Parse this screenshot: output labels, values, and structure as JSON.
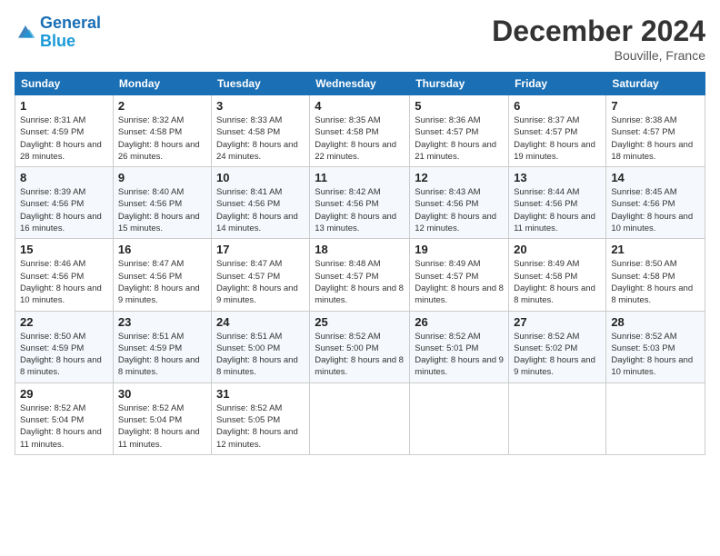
{
  "header": {
    "logo_line1": "General",
    "logo_line2": "Blue",
    "month": "December 2024",
    "location": "Bouville, France"
  },
  "weekdays": [
    "Sunday",
    "Monday",
    "Tuesday",
    "Wednesday",
    "Thursday",
    "Friday",
    "Saturday"
  ],
  "weeks": [
    [
      {
        "day": "1",
        "sunrise": "8:31 AM",
        "sunset": "4:59 PM",
        "daylight": "8 hours and 28 minutes."
      },
      {
        "day": "2",
        "sunrise": "8:32 AM",
        "sunset": "4:58 PM",
        "daylight": "8 hours and 26 minutes."
      },
      {
        "day": "3",
        "sunrise": "8:33 AM",
        "sunset": "4:58 PM",
        "daylight": "8 hours and 24 minutes."
      },
      {
        "day": "4",
        "sunrise": "8:35 AM",
        "sunset": "4:58 PM",
        "daylight": "8 hours and 22 minutes."
      },
      {
        "day": "5",
        "sunrise": "8:36 AM",
        "sunset": "4:57 PM",
        "daylight": "8 hours and 21 minutes."
      },
      {
        "day": "6",
        "sunrise": "8:37 AM",
        "sunset": "4:57 PM",
        "daylight": "8 hours and 19 minutes."
      },
      {
        "day": "7",
        "sunrise": "8:38 AM",
        "sunset": "4:57 PM",
        "daylight": "8 hours and 18 minutes."
      }
    ],
    [
      {
        "day": "8",
        "sunrise": "8:39 AM",
        "sunset": "4:56 PM",
        "daylight": "8 hours and 16 minutes."
      },
      {
        "day": "9",
        "sunrise": "8:40 AM",
        "sunset": "4:56 PM",
        "daylight": "8 hours and 15 minutes."
      },
      {
        "day": "10",
        "sunrise": "8:41 AM",
        "sunset": "4:56 PM",
        "daylight": "8 hours and 14 minutes."
      },
      {
        "day": "11",
        "sunrise": "8:42 AM",
        "sunset": "4:56 PM",
        "daylight": "8 hours and 13 minutes."
      },
      {
        "day": "12",
        "sunrise": "8:43 AM",
        "sunset": "4:56 PM",
        "daylight": "8 hours and 12 minutes."
      },
      {
        "day": "13",
        "sunrise": "8:44 AM",
        "sunset": "4:56 PM",
        "daylight": "8 hours and 11 minutes."
      },
      {
        "day": "14",
        "sunrise": "8:45 AM",
        "sunset": "4:56 PM",
        "daylight": "8 hours and 10 minutes."
      }
    ],
    [
      {
        "day": "15",
        "sunrise": "8:46 AM",
        "sunset": "4:56 PM",
        "daylight": "8 hours and 10 minutes."
      },
      {
        "day": "16",
        "sunrise": "8:47 AM",
        "sunset": "4:56 PM",
        "daylight": "8 hours and 9 minutes."
      },
      {
        "day": "17",
        "sunrise": "8:47 AM",
        "sunset": "4:57 PM",
        "daylight": "8 hours and 9 minutes."
      },
      {
        "day": "18",
        "sunrise": "8:48 AM",
        "sunset": "4:57 PM",
        "daylight": "8 hours and 8 minutes."
      },
      {
        "day": "19",
        "sunrise": "8:49 AM",
        "sunset": "4:57 PM",
        "daylight": "8 hours and 8 minutes."
      },
      {
        "day": "20",
        "sunrise": "8:49 AM",
        "sunset": "4:58 PM",
        "daylight": "8 hours and 8 minutes."
      },
      {
        "day": "21",
        "sunrise": "8:50 AM",
        "sunset": "4:58 PM",
        "daylight": "8 hours and 8 minutes."
      }
    ],
    [
      {
        "day": "22",
        "sunrise": "8:50 AM",
        "sunset": "4:59 PM",
        "daylight": "8 hours and 8 minutes."
      },
      {
        "day": "23",
        "sunrise": "8:51 AM",
        "sunset": "4:59 PM",
        "daylight": "8 hours and 8 minutes."
      },
      {
        "day": "24",
        "sunrise": "8:51 AM",
        "sunset": "5:00 PM",
        "daylight": "8 hours and 8 minutes."
      },
      {
        "day": "25",
        "sunrise": "8:52 AM",
        "sunset": "5:00 PM",
        "daylight": "8 hours and 8 minutes."
      },
      {
        "day": "26",
        "sunrise": "8:52 AM",
        "sunset": "5:01 PM",
        "daylight": "8 hours and 9 minutes."
      },
      {
        "day": "27",
        "sunrise": "8:52 AM",
        "sunset": "5:02 PM",
        "daylight": "8 hours and 9 minutes."
      },
      {
        "day": "28",
        "sunrise": "8:52 AM",
        "sunset": "5:03 PM",
        "daylight": "8 hours and 10 minutes."
      }
    ],
    [
      {
        "day": "29",
        "sunrise": "8:52 AM",
        "sunset": "5:04 PM",
        "daylight": "8 hours and 11 minutes."
      },
      {
        "day": "30",
        "sunrise": "8:52 AM",
        "sunset": "5:04 PM",
        "daylight": "8 hours and 11 minutes."
      },
      {
        "day": "31",
        "sunrise": "8:52 AM",
        "sunset": "5:05 PM",
        "daylight": "8 hours and 12 minutes."
      },
      null,
      null,
      null,
      null
    ]
  ]
}
